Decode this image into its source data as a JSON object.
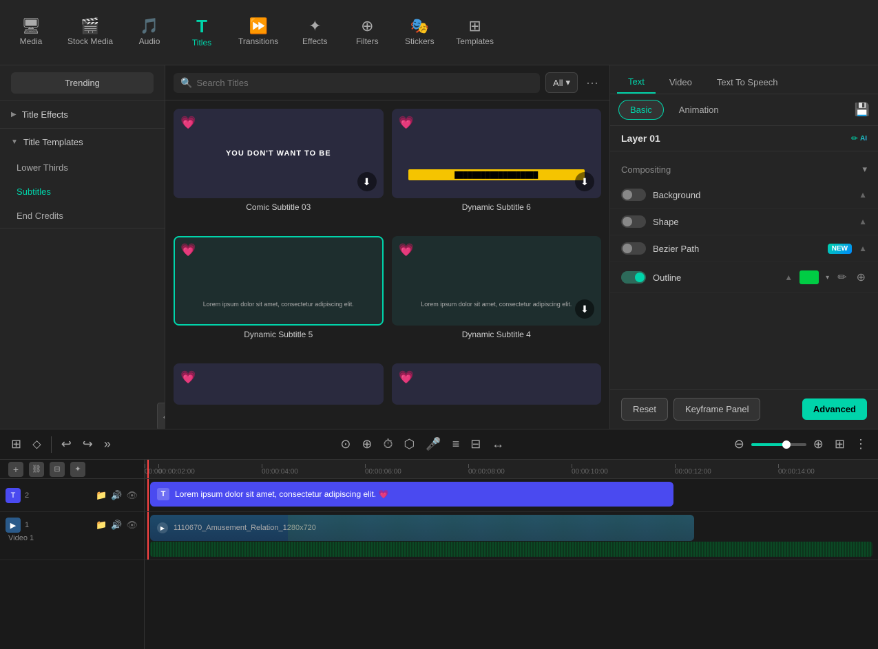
{
  "nav": {
    "items": [
      {
        "id": "media",
        "label": "Media",
        "icon": "🖥",
        "active": false
      },
      {
        "id": "stock-media",
        "label": "Stock Media",
        "icon": "🎬",
        "active": false
      },
      {
        "id": "audio",
        "label": "Audio",
        "icon": "🎵",
        "active": false
      },
      {
        "id": "titles",
        "label": "Titles",
        "icon": "T",
        "active": true
      },
      {
        "id": "transitions",
        "label": "Transitions",
        "icon": "▶",
        "active": false
      },
      {
        "id": "effects",
        "label": "Effects",
        "icon": "✦",
        "active": false
      },
      {
        "id": "filters",
        "label": "Filters",
        "icon": "⊕",
        "active": false
      },
      {
        "id": "stickers",
        "label": "Stickers",
        "icon": "🎭",
        "active": false
      },
      {
        "id": "templates",
        "label": "Templates",
        "icon": "⊞",
        "active": false
      }
    ]
  },
  "sidebar": {
    "trending_label": "Trending",
    "sections": [
      {
        "id": "title-effects",
        "label": "Title Effects",
        "expanded": false
      },
      {
        "id": "title-templates",
        "label": "Title Templates",
        "expanded": true,
        "children": [
          {
            "id": "lower-thirds",
            "label": "Lower Thirds",
            "active": false
          },
          {
            "id": "subtitles",
            "label": "Subtitles",
            "active": true
          },
          {
            "id": "end-credits",
            "label": "End Credits",
            "active": false
          }
        ]
      }
    ]
  },
  "search": {
    "placeholder": "Search Titles",
    "filter_label": "All"
  },
  "thumbnails": [
    {
      "id": "comic-subtitle-03",
      "label": "Comic Subtitle 03",
      "type": "comic",
      "selected": false
    },
    {
      "id": "dynamic-subtitle-6",
      "label": "Dynamic Subtitle 6",
      "type": "dynamic-bar",
      "selected": false
    },
    {
      "id": "dynamic-subtitle-5",
      "label": "Dynamic Subtitle 5",
      "type": "lorem",
      "selected": true
    },
    {
      "id": "dynamic-subtitle-4",
      "label": "Dynamic Subtitle 4",
      "type": "lorem2",
      "selected": false
    }
  ],
  "right_panel": {
    "tabs": [
      {
        "id": "text",
        "label": "Text",
        "active": true
      },
      {
        "id": "video",
        "label": "Video",
        "active": false
      },
      {
        "id": "text-to-speech",
        "label": "Text To Speech",
        "active": false
      }
    ],
    "sub_tabs": [
      {
        "id": "basic",
        "label": "Basic",
        "active": true
      },
      {
        "id": "animation",
        "label": "Animation",
        "active": false
      }
    ],
    "save_icon": "💾",
    "layer_title": "Layer 01",
    "ai_label": "AI",
    "compositing_label": "Compositing",
    "properties": [
      {
        "id": "background",
        "label": "Background",
        "enabled": false,
        "type": "toggle-up"
      },
      {
        "id": "shape",
        "label": "Shape",
        "enabled": false,
        "type": "toggle-up"
      },
      {
        "id": "bezier-path",
        "label": "Bezier Path",
        "enabled": false,
        "type": "toggle-new-up",
        "badge": "NEW"
      },
      {
        "id": "outline",
        "label": "Outline",
        "enabled": true,
        "type": "toggle-color",
        "color": "#00cc44"
      }
    ],
    "footer": {
      "reset_label": "Reset",
      "keyframe_label": "Keyframe Panel",
      "advanced_label": "Advanced"
    }
  },
  "timeline": {
    "toolbar_tools": [
      "⊞",
      "⬦",
      "|",
      "↩",
      "↪",
      "»"
    ],
    "center_tools": [
      "⊙",
      "⊕",
      "⏱",
      "⬡",
      "🎤",
      "≡",
      "⊟",
      "↔"
    ],
    "tracks": [
      {
        "id": "text-track",
        "num": "2",
        "type": "text",
        "clip_text": "Lorem ipsum dolor sit amet, consectetur adipiscing elit. 💗",
        "clip_color": "#4a4af0"
      },
      {
        "id": "video-track",
        "num": "1",
        "type": "video",
        "clip_text": "1110670_Amusement_Relation_1280x720",
        "label": "Video 1"
      }
    ],
    "ruler_marks": [
      "00:00",
      "00:00:02:00",
      "00:00:04:00",
      "00:00:06:00",
      "00:00:08:00",
      "00:00:10:00",
      "00:00:12:00",
      "00:00:14:00"
    ]
  }
}
